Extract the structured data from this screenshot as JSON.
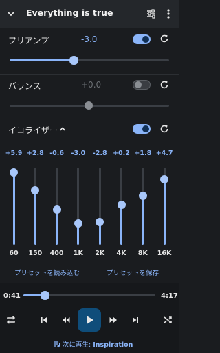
{
  "header": {
    "title": "Everything is true"
  },
  "preamp": {
    "label": "プリアンプ",
    "value": "-3.0",
    "enabled": true,
    "level": 0.34
  },
  "balance": {
    "label": "バランス",
    "value": "+0.0",
    "enabled": false,
    "level": 0.5
  },
  "equalizer": {
    "label": "イコライザー",
    "enabled": true,
    "bands": [
      {
        "freq": "60",
        "gain": "+5.9"
      },
      {
        "freq": "150",
        "gain": "+2.8"
      },
      {
        "freq": "400",
        "gain": "-0.6"
      },
      {
        "freq": "1K",
        "gain": "-3.0"
      },
      {
        "freq": "2K",
        "gain": "-2.8"
      },
      {
        "freq": "4K",
        "gain": "+0.2"
      },
      {
        "freq": "8K",
        "gain": "+1.8"
      },
      {
        "freq": "16K",
        "gain": "+4.7"
      }
    ],
    "load_preset": "プリセットを読み込む",
    "save_preset": "プリセットを保存"
  },
  "player": {
    "elapsed": "0:41",
    "duration": "4:17",
    "progress": 0.16,
    "up_next_label": "次に再生:",
    "up_next_title": "Inspiration"
  },
  "colors": {
    "accent": "#8ab4f8",
    "background": "#1a1c1f",
    "header": "#24272b",
    "play_button": "#0f4d7a"
  }
}
